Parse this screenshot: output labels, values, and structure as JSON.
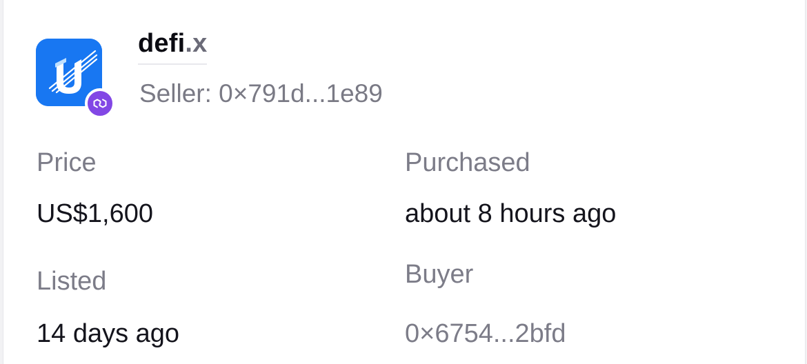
{
  "domain": {
    "name": "defi",
    "tld": ".x"
  },
  "seller": {
    "label": "Seller:",
    "address": "0×791d...1e89"
  },
  "details": {
    "price_label": "Price",
    "price_value": "US$1,600",
    "purchased_label": "Purchased",
    "purchased_value": "about 8 hours ago",
    "listed_label": "Listed",
    "listed_value": "14 days ago",
    "buyer_label": "Buyer",
    "buyer_value": "0×6754...2bfd"
  },
  "icons": {
    "logo": "unstoppable-domains-logo",
    "chain_badge": "polygon-icon"
  },
  "colors": {
    "logo_blue": "#1877f2",
    "polygon_purple": "#8247e5"
  }
}
